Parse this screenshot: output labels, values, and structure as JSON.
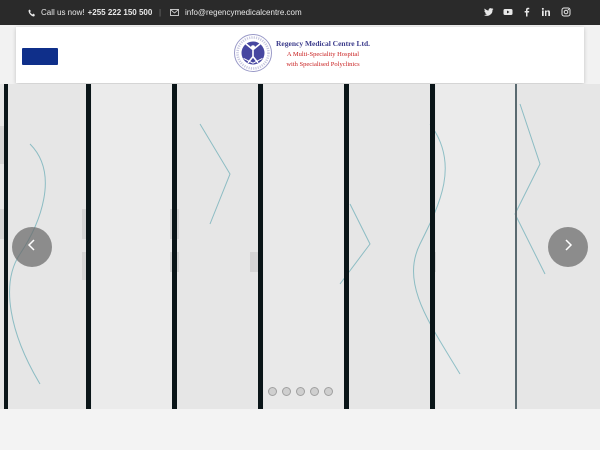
{
  "topbar": {
    "call_label": "Call us now!",
    "phone": "+255 222 150 500",
    "separator": "|",
    "email": "info@regencymedicalcentre.com",
    "icons": [
      "phone-icon",
      "envelope-icon",
      "twitter-icon",
      "youtube-icon",
      "facebook-icon",
      "linkedin-icon",
      "instagram-icon"
    ]
  },
  "header": {
    "menu_button_icon": "menu-button",
    "logo": {
      "name": "Regency Medical Centre Ltd.",
      "tagline_line1": "A Multi-Speciality Hospital",
      "tagline_line2": "with Specialised Polyclinics"
    }
  },
  "slider": {
    "prev_icon": "chevron-left-icon",
    "next_icon": "chevron-right-icon",
    "slide_count": 5,
    "active_index": 0
  },
  "colors": {
    "topbar_bg": "#2a2a2a",
    "menu_button": "#0f2f8a",
    "logo_name": "#3c3c8c",
    "logo_tagline": "#c81e1e"
  }
}
